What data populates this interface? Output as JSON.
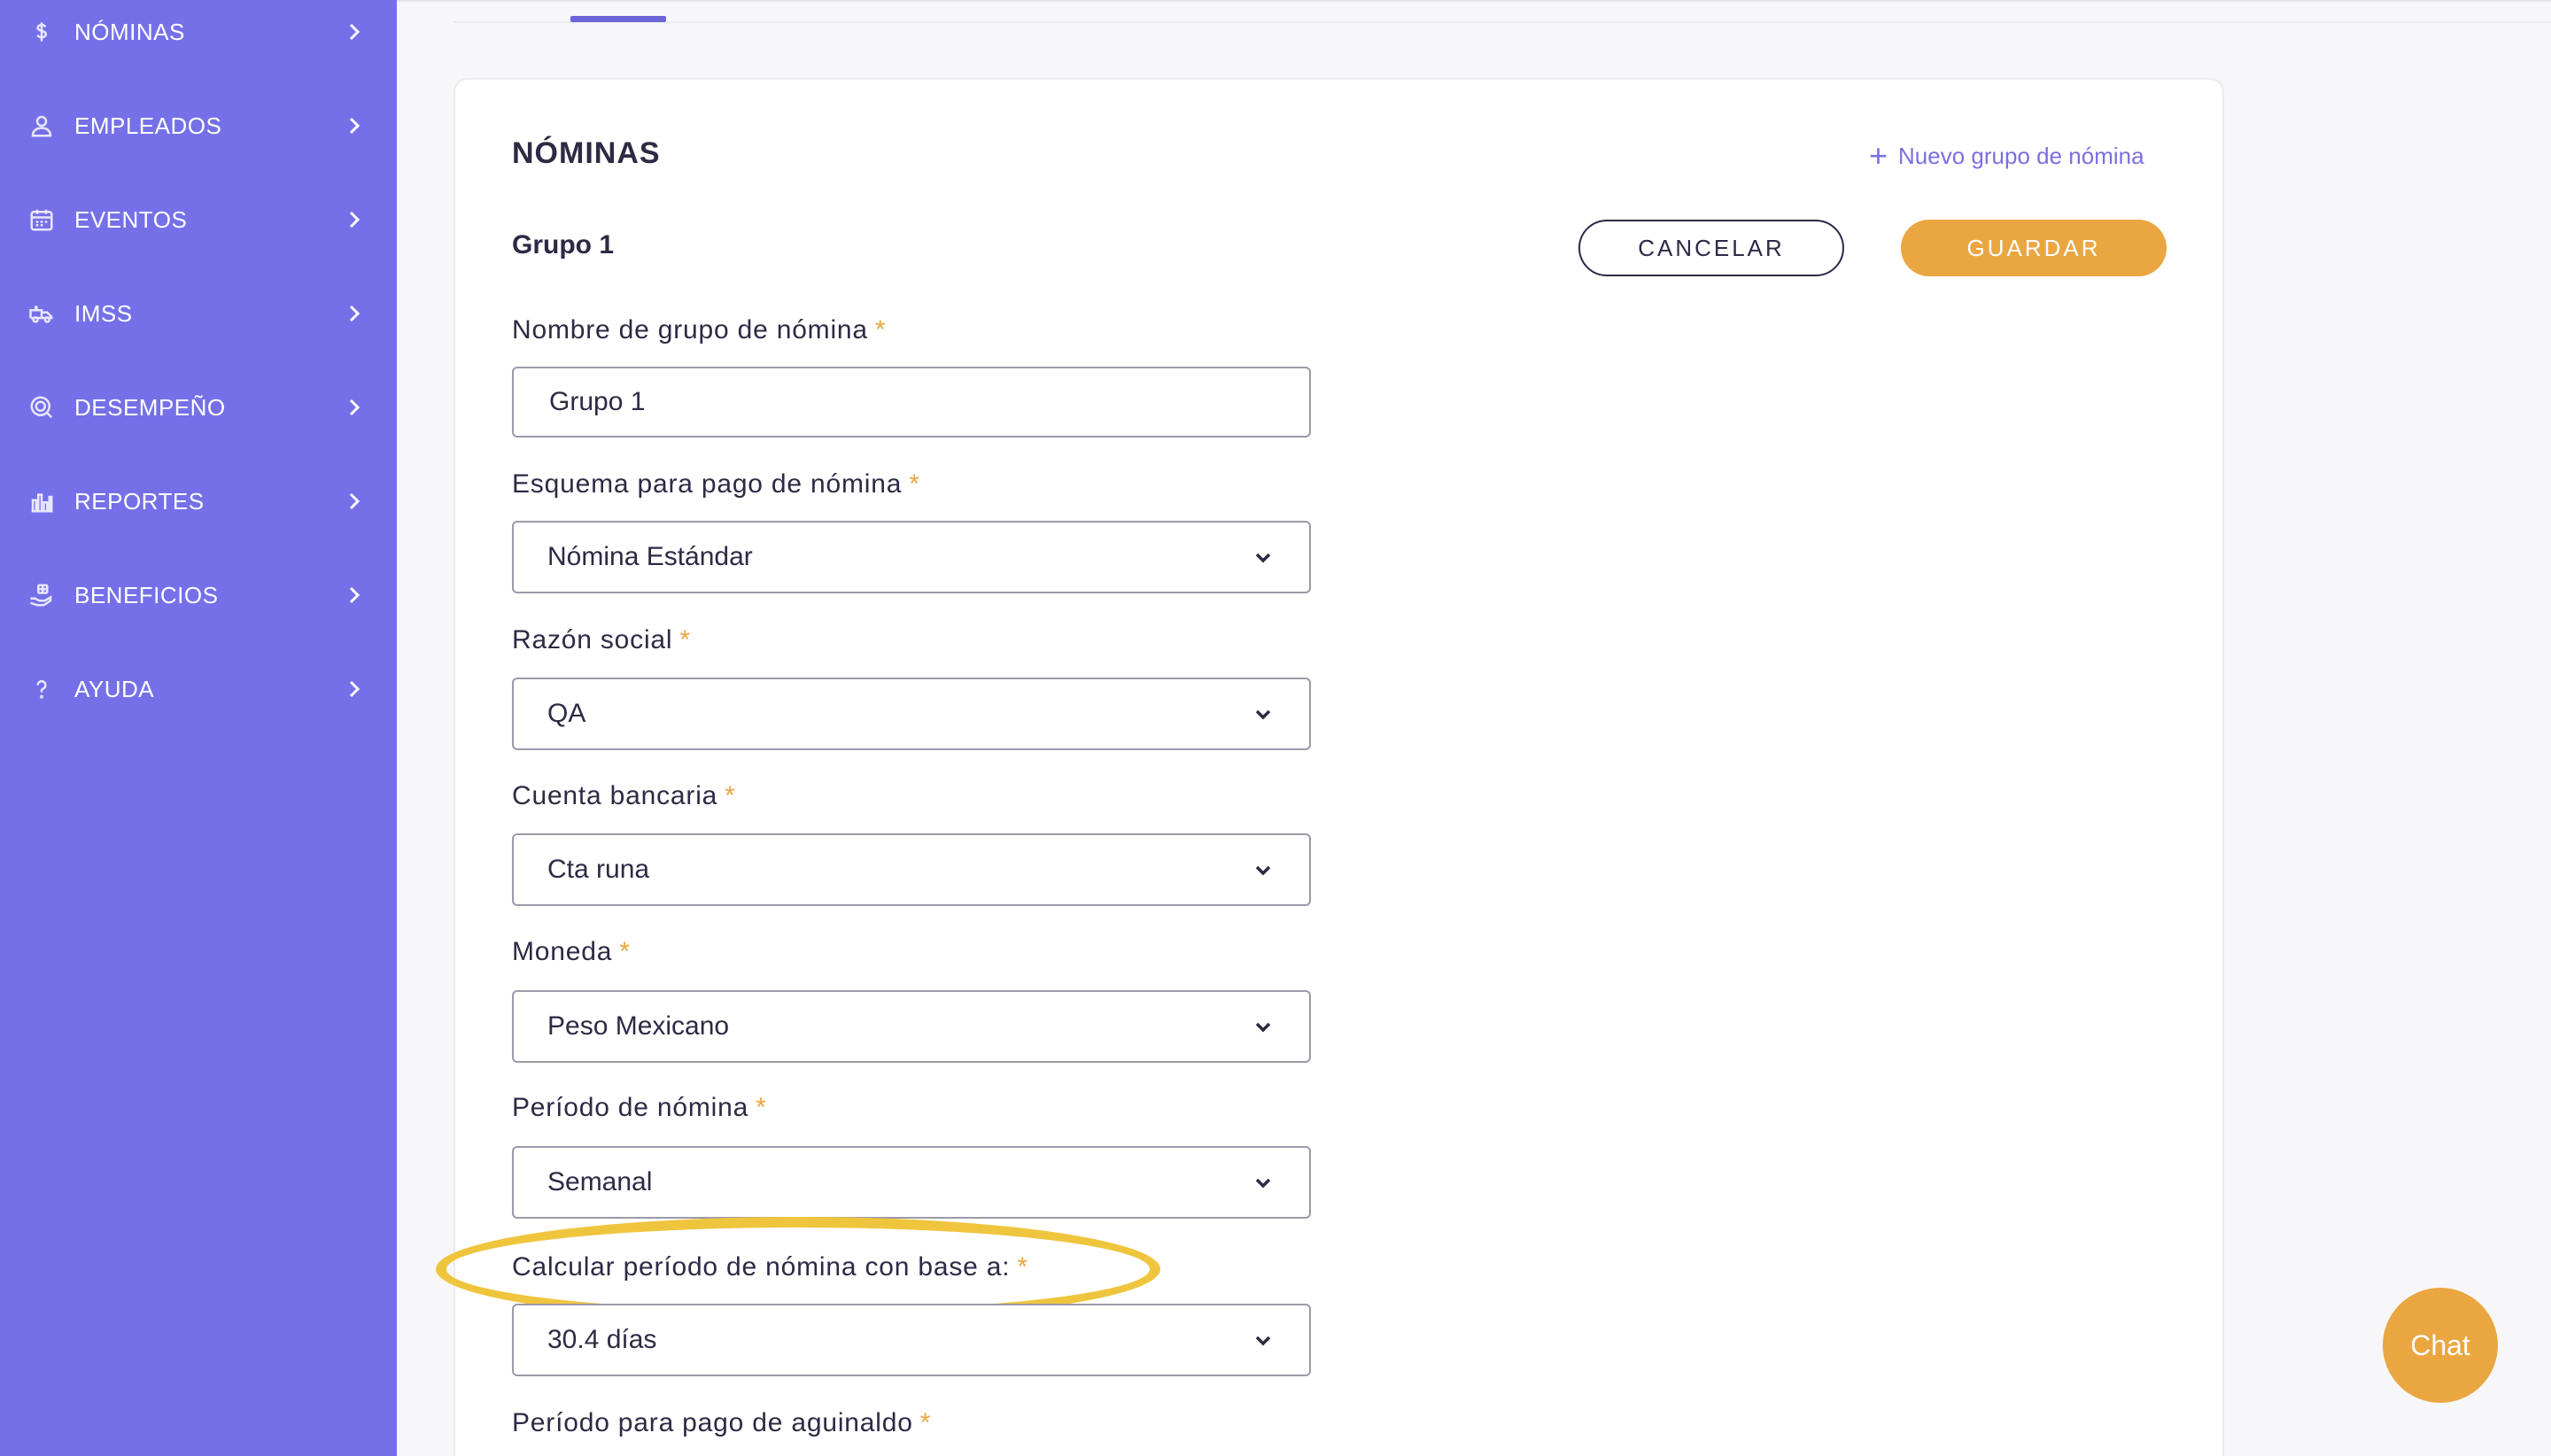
{
  "sidebar": {
    "items": [
      {
        "label": "NÓMINAS",
        "icon": "dollar-icon"
      },
      {
        "label": "EMPLEADOS",
        "icon": "user-icon"
      },
      {
        "label": "EVENTOS",
        "icon": "calendar-icon"
      },
      {
        "label": "IMSS",
        "icon": "ambulance-icon"
      },
      {
        "label": "DESEMPEÑO",
        "icon": "performance-icon"
      },
      {
        "label": "REPORTES",
        "icon": "bar-chart-icon"
      },
      {
        "label": "BENEFICIOS",
        "icon": "gift-hand-icon"
      },
      {
        "label": "AYUDA",
        "icon": "question-icon"
      }
    ]
  },
  "page": {
    "title": "NÓMINAS",
    "new_group_link": "Nuevo grupo de nómina"
  },
  "group": {
    "title": "Grupo 1"
  },
  "actions": {
    "cancel_label": "CANCELAR",
    "save_label": "GUARDAR"
  },
  "form": {
    "group_name": {
      "label": "Nombre de grupo de nómina",
      "value": "Grupo 1"
    },
    "payment_scheme": {
      "label": "Esquema para pago de nómina",
      "value": "Nómina Estándar"
    },
    "company_name": {
      "label": "Razón social",
      "value": "QA"
    },
    "bank_account": {
      "label": "Cuenta bancaria",
      "value": "Cta runa"
    },
    "currency": {
      "label": "Moneda",
      "value": "Peso Mexicano"
    },
    "payroll_period": {
      "label": "Período de nómina",
      "value": "Semanal"
    },
    "calc_base": {
      "label": "Calcular período de nómina con base a:",
      "value": "30.4 días"
    },
    "bonus_period": {
      "label": "Período para pago de aguinaldo"
    }
  },
  "required_marker": "*",
  "chat": {
    "label": "Chat"
  },
  "colors": {
    "sidebar_bg": "#7570e8",
    "accent": "#eaa641",
    "link": "#7a6fe0",
    "highlight": "#f0c53e"
  }
}
